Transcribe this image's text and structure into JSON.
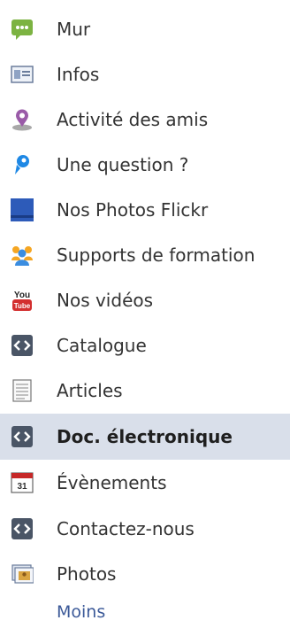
{
  "menu": {
    "items": [
      {
        "label": "Mur",
        "icon": "wall-icon"
      },
      {
        "label": "Infos",
        "icon": "info-card-icon"
      },
      {
        "label": "Activité des amis",
        "icon": "map-pin-icon"
      },
      {
        "label": "Une question ?",
        "icon": "question-icon"
      },
      {
        "label": "Nos Photos Flickr",
        "icon": "flickr-icon"
      },
      {
        "label": "Supports de formation",
        "icon": "people-icon"
      },
      {
        "label": "Nos vidéos",
        "icon": "youtube-icon"
      },
      {
        "label": "Catalogue",
        "icon": "code-icon"
      },
      {
        "label": "Articles",
        "icon": "notes-icon"
      },
      {
        "label": "Doc. électronique",
        "icon": "code-icon",
        "selected": true
      },
      {
        "label": "Évènements",
        "icon": "calendar-icon",
        "calendar_day": "31"
      },
      {
        "label": "Contactez-nous",
        "icon": "code-icon"
      },
      {
        "label": "Photos",
        "icon": "photos-icon"
      }
    ],
    "more_label": "Moins"
  },
  "colors": {
    "selected_bg": "#d9dfea",
    "link": "#3b5998",
    "text": "#333333"
  }
}
